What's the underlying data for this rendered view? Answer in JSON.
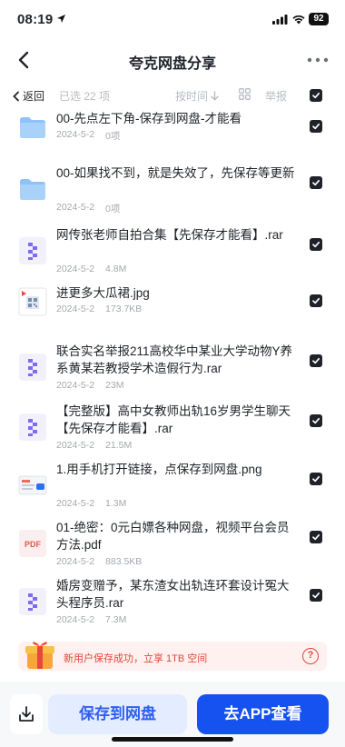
{
  "status": {
    "time": "08:19",
    "battery": "92"
  },
  "header": {
    "title": "夸克网盘分享"
  },
  "toolbar": {
    "back_label": "返回",
    "selected_text": "已选 22 项",
    "sort_label": "按时间",
    "report_label": "举报"
  },
  "files": [
    {
      "name": "00-先点左下角-保存到网盘-才能看",
      "date": "2024-5-2",
      "size": "0项",
      "icon": "folder-icon"
    },
    {
      "name": "00-如果找不到，就是失效了，先保存等更新",
      "date": "2024-5-2",
      "size": "0项",
      "icon": "folder-icon"
    },
    {
      "name": "网传张老师自拍合集【先保存才能看】.rar",
      "date": "2024-5-2",
      "size": "4.8M",
      "icon": "archive-icon"
    },
    {
      "name": "进更多大瓜裙.jpg",
      "date": "2024-5-2",
      "size": "173.7KB",
      "icon": "qr-image-icon"
    },
    {
      "name": "联合实名举报211高校华中某业大学动物Y养系黄某若教授学术造假行为.rar",
      "date": "2024-5-2",
      "size": "23M",
      "icon": "archive-icon"
    },
    {
      "name": "【完整版】高中女教师出轨16岁男学生聊天【先保存才能看】.rar",
      "date": "2024-5-2",
      "size": "21.5M",
      "icon": "archive-icon"
    },
    {
      "name": "1.用手机打开链接，点保存到网盘.png",
      "date": "2024-5-2",
      "size": "1.3M",
      "icon": "image-thumb-icon"
    },
    {
      "name": "01-绝密：0元白嫖各种网盘，视频平台会员方法.pdf",
      "date": "2024-5-2",
      "size": "883.5KB",
      "icon": "pdf-icon",
      "badge": "PDF"
    },
    {
      "name": "婚房变赠予，某东渣女出轨连环套设计冤大头程序员.rar",
      "date": "2024-5-2",
      "size": "7.3M",
      "icon": "archive-icon"
    }
  ],
  "promo": {
    "text": "新用户保存成功，立享 1TB 空间",
    "help": "?"
  },
  "actions": {
    "save_label": "保存到网盘",
    "app_label": "去APP查看"
  },
  "colors": {
    "accent": "#1652f0",
    "save_bg": "#e4ecff",
    "promo_red": "#e0463a",
    "folder": "#8fc3f7",
    "archive": "#7d6cf0"
  }
}
